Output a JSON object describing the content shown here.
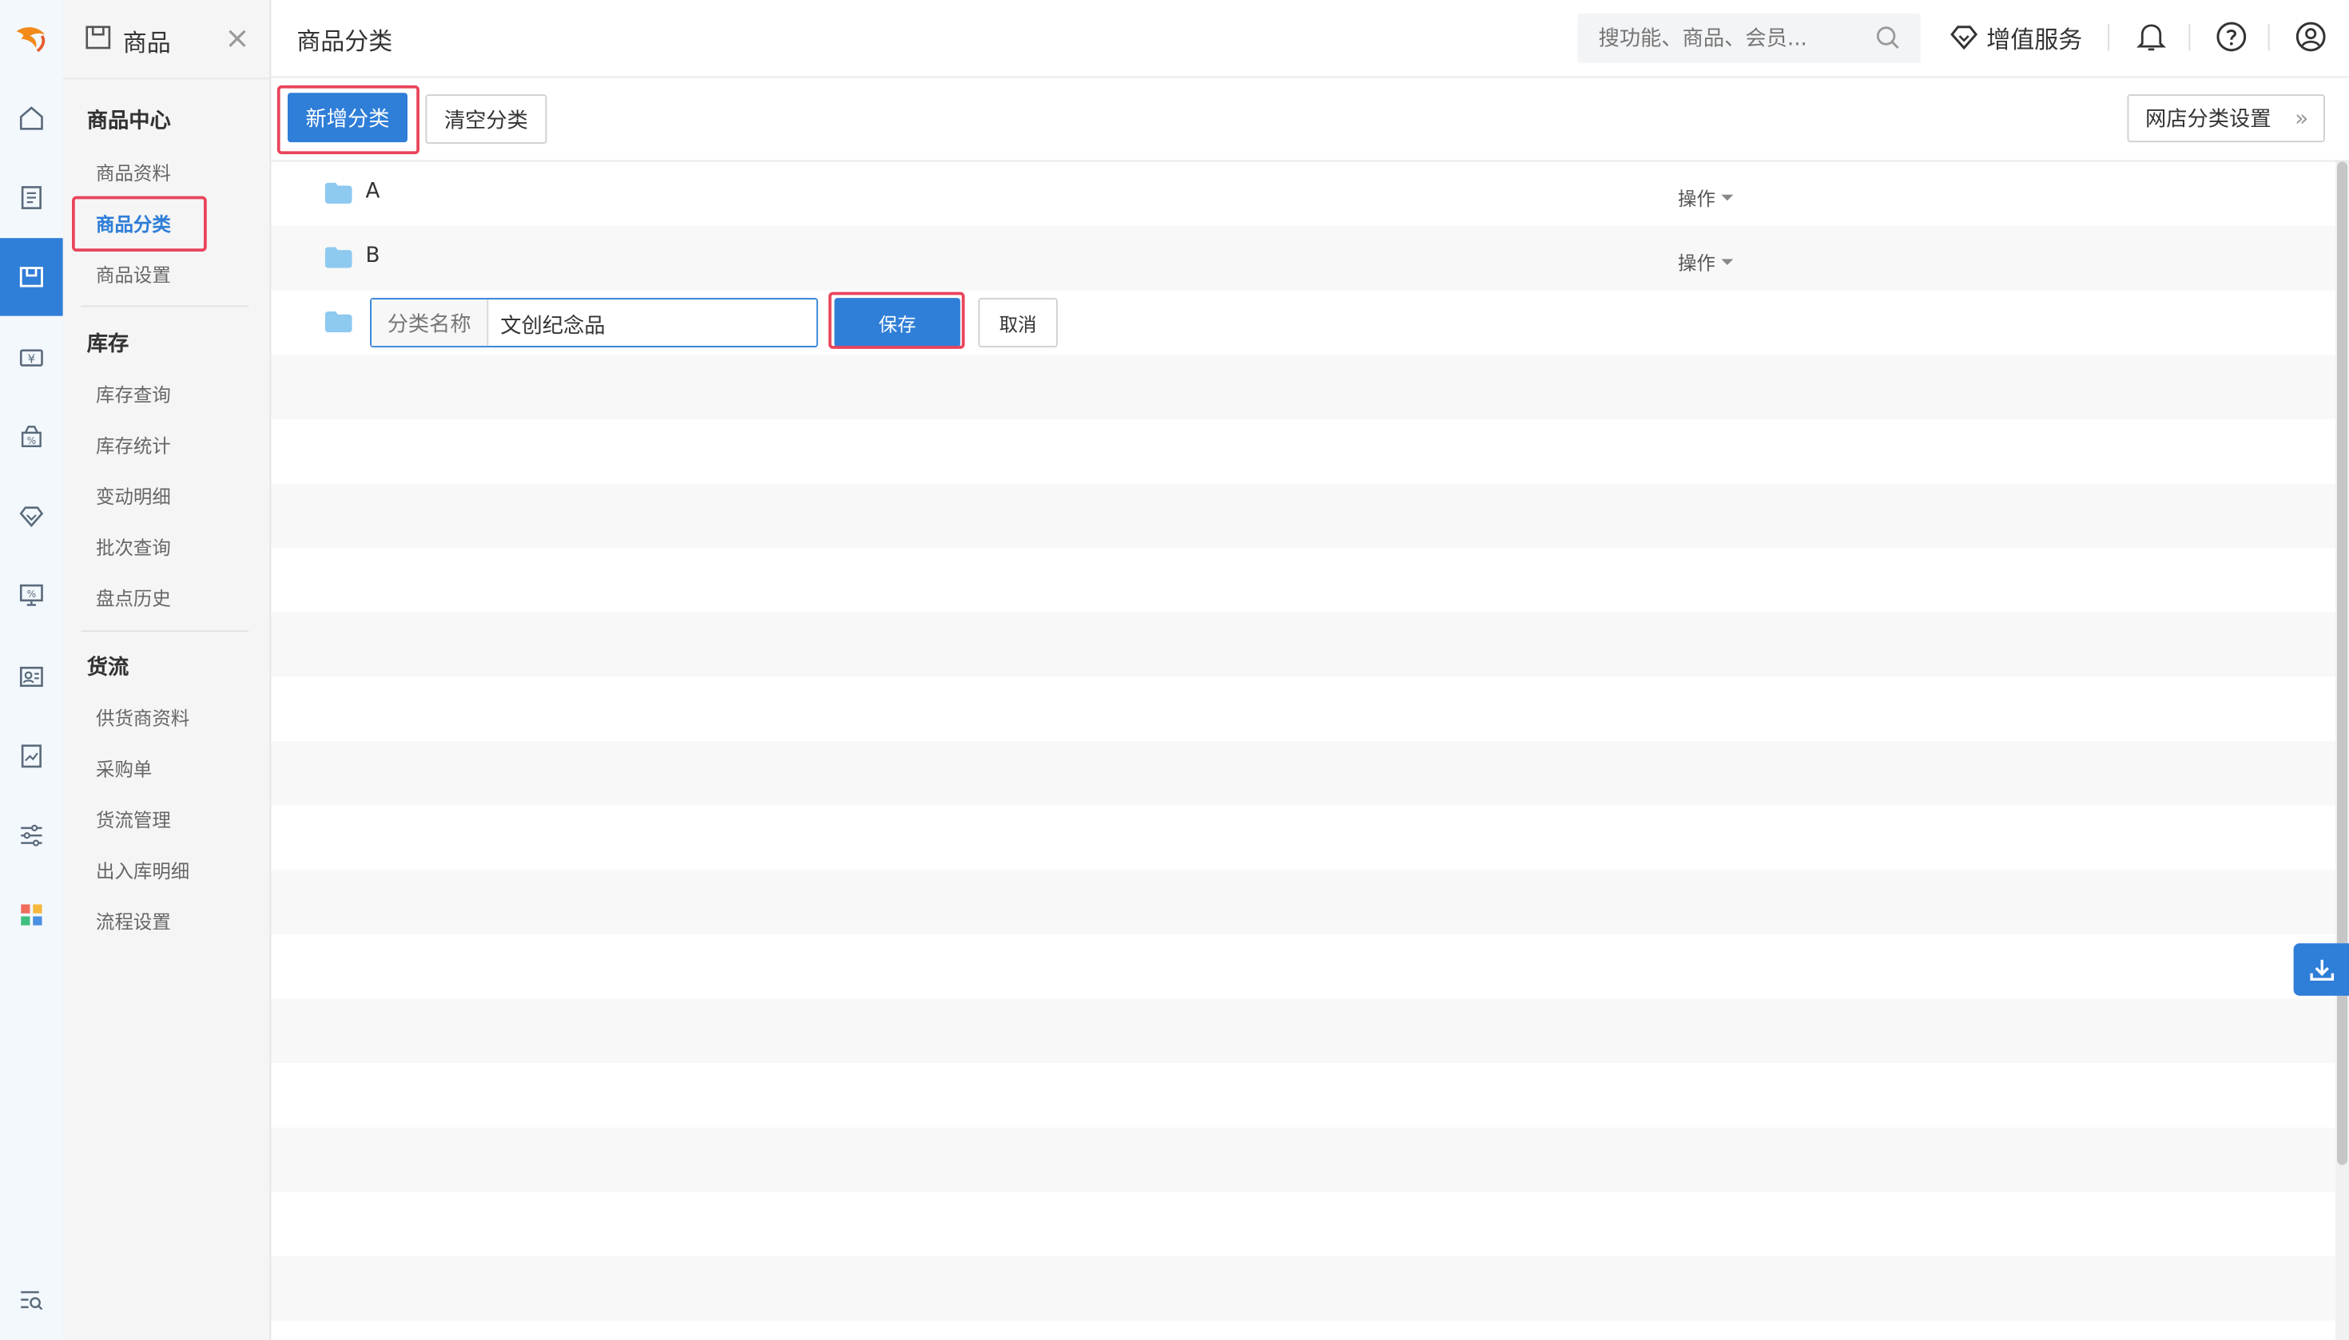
{
  "sidebar": {
    "title": "商品",
    "groups": [
      {
        "title": "商品中心",
        "items": [
          "商品资料",
          "商品分类",
          "商品设置"
        ]
      },
      {
        "title": "库存",
        "items": [
          "库存查询",
          "库存统计",
          "变动明细",
          "批次查询",
          "盘点历史"
        ]
      },
      {
        "title": "货流",
        "items": [
          "供货商资料",
          "采购单",
          "货流管理",
          "出入库明细",
          "流程设置"
        ]
      }
    ],
    "active_item": "商品分类"
  },
  "header": {
    "page_title": "商品分类",
    "search_placeholder": "搜功能、商品、会员...",
    "vip_label": "增值服务"
  },
  "toolbar": {
    "add_category": "新增分类",
    "clear_category": "清空分类",
    "online_store_settings": "网店分类设置"
  },
  "categories": [
    {
      "name": "A",
      "action": "操作"
    },
    {
      "name": "B",
      "action": "操作"
    }
  ],
  "new_category_form": {
    "label": "分类名称",
    "value": "文创纪念品",
    "save": "保存",
    "cancel": "取消"
  },
  "colors": {
    "primary": "#2f7ed8",
    "highlight": "#e9445b",
    "folder": "#8ec9f0"
  }
}
